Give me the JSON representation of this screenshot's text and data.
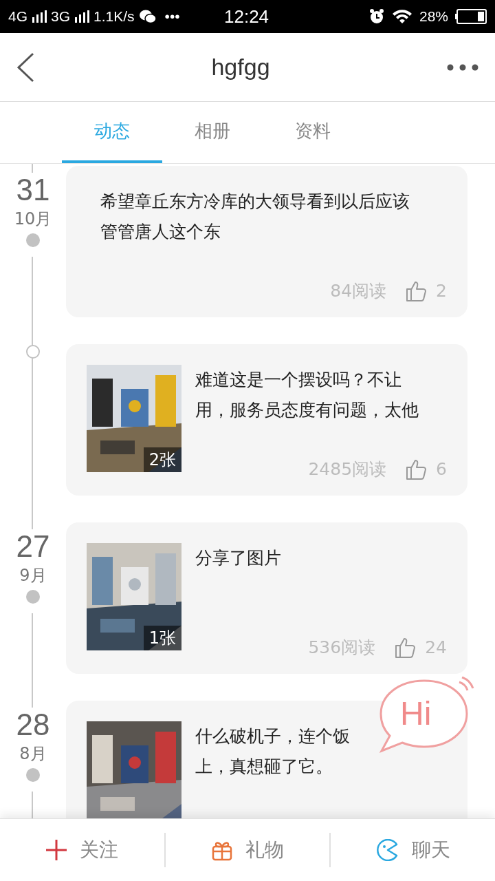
{
  "status_bar": {
    "network_1": "4G",
    "network_2": "3G",
    "speed": "1.1K/s",
    "more": "•••",
    "time": "12:24",
    "battery": "28%"
  },
  "header": {
    "title": "hgfgg"
  },
  "tabs": [
    {
      "label": "动态",
      "selected": true
    },
    {
      "label": "相册",
      "selected": false
    },
    {
      "label": "资料",
      "selected": false
    }
  ],
  "posts": [
    {
      "date": {
        "day": "31",
        "month": "10月"
      },
      "lines": [
        "希望章丘东方冷库的大领导看到以后应该",
        "管管唐人这个东"
      ],
      "reads": "84阅读",
      "likes": "2"
    },
    {
      "lines": [
        "难道这是一个摆设吗？不让",
        "用，服务员态度有问题，太他"
      ],
      "image": {
        "kind": "picture",
        "count": "2张"
      },
      "reads": "2485阅读",
      "likes": "6"
    },
    {
      "date": {
        "day": "27",
        "month": "9月"
      },
      "lines": [
        "分享了图片"
      ],
      "image": {
        "kind": "picture",
        "count": "1张"
      },
      "reads": "536阅读",
      "likes": "24"
    },
    {
      "date": {
        "day": "28",
        "month": "8月"
      },
      "lines": [
        "什么破机子，连个饭",
        "上，真想砸了它。"
      ],
      "image": {
        "kind": "picture"
      }
    }
  ],
  "hi_bubble": {
    "label": "Hi"
  },
  "bottom_bar": [
    {
      "kind": "follow",
      "label": "关注"
    },
    {
      "kind": "gift",
      "label": "礼物"
    },
    {
      "kind": "chat",
      "label": "聊天"
    }
  ]
}
